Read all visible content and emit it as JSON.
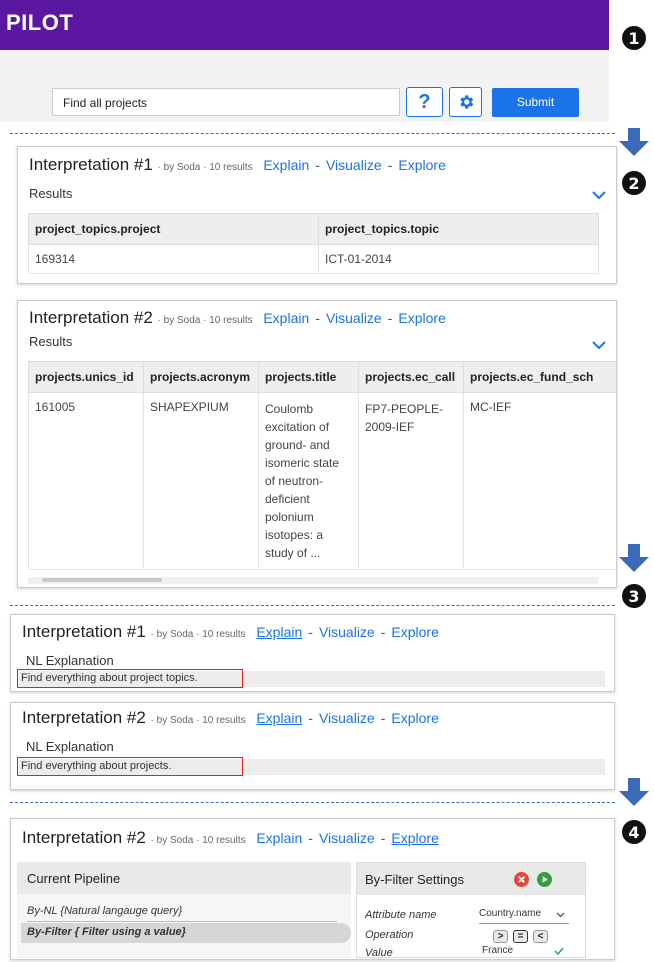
{
  "app": {
    "logo": "PILOT"
  },
  "search": {
    "value": "Find all projects",
    "help_label": "?",
    "submit_label": "Submit"
  },
  "steps": [
    "1",
    "2",
    "3",
    "4"
  ],
  "interp1": {
    "title": "Interpretation #1",
    "by": "by Soda",
    "count": "10 results",
    "explain": "Explain",
    "visualize": "Visualize",
    "explore": "Explore",
    "results_label": "Results",
    "headers": [
      "project_topics.project",
      "project_topics.topic"
    ],
    "rows": [
      [
        "169314",
        "ICT-01-2014"
      ]
    ]
  },
  "interp2": {
    "title": "Interpretation #2",
    "by": "by Soda",
    "count": "10 results",
    "explain": "Explain",
    "visualize": "Visualize",
    "explore": "Explore",
    "results_label": "Results",
    "headers": [
      "projects.unics_id",
      "projects.acronym",
      "projects.title",
      "projects.ec_call",
      "projects.ec_fund_sch"
    ],
    "rows": [
      [
        "161005",
        "SHAPEXPIUM",
        "Coulomb excitation of ground- and isomeric state of neutron-deficient polonium isotopes: a study of ...",
        "FP7-PEOPLE-2009-IEF",
        "MC-IEF"
      ]
    ]
  },
  "explain1": {
    "title": "Interpretation #1",
    "by": "by Soda",
    "count": "10 results",
    "explain": "Explain",
    "visualize": "Visualize",
    "explore": "Explore",
    "nl_label": "NL Explanation",
    "nl_text": "Find everything about project topics."
  },
  "explain2": {
    "title": "Interpretation #2",
    "by": "by Soda",
    "count": "10 results",
    "explain": "Explain",
    "visualize": "Visualize",
    "explore": "Explore",
    "nl_label": "NL Explanation",
    "nl_text": "Find everything about projects."
  },
  "explore": {
    "title": "Interpretation #2",
    "by": "by Soda",
    "count": "10 results",
    "explain": "Explain",
    "visualize": "Visualize",
    "explore": "Explore",
    "pipeline_title": "Current Pipeline",
    "pipeline_items": [
      "By-NL {Natural langauge query}",
      "By-Filter { Filter using a value}"
    ],
    "filter_title": "By-Filter Settings",
    "attr_label": "Attribute name",
    "attr_value": "Country.name",
    "op_label": "Operation",
    "ops": [
      ">",
      "=",
      "<"
    ],
    "value_label": "Value",
    "value_value": "France"
  },
  "colors": {
    "header": "#5b17a0",
    "accent": "#1a73e8",
    "highlight": "#e02020"
  }
}
